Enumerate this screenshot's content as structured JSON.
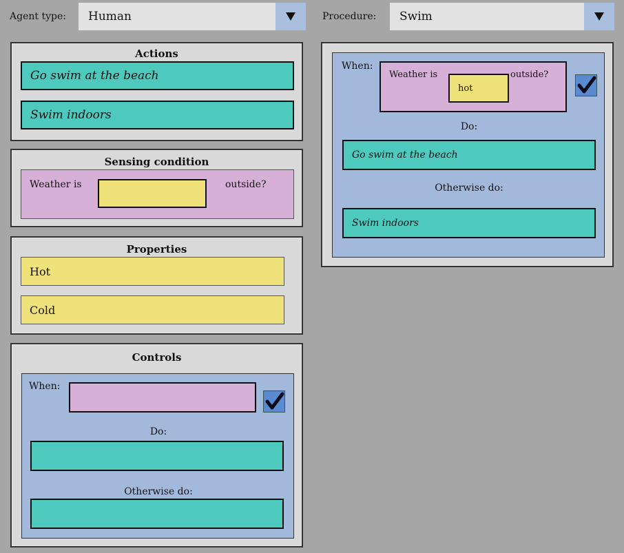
{
  "agent_type": {
    "label": "Agent type:",
    "value": "Human"
  },
  "procedure": {
    "label": "Procedure:",
    "value": "Swim"
  },
  "actions": {
    "title": "Actions",
    "items": [
      "Go swim at the beach",
      "Swim indoors"
    ]
  },
  "sensing": {
    "title": "Sensing condition",
    "prefix": "Weather is",
    "suffix": "outside?"
  },
  "properties": {
    "title": "Properties",
    "items": [
      "Hot",
      "Cold"
    ]
  },
  "controls": {
    "title": "Controls",
    "when": "When:",
    "do": "Do:",
    "otherwise": "Otherwise do:",
    "checked": true
  },
  "procedure_body": {
    "when": "When:",
    "cond_prefix": "Weather is",
    "cond_value": "hot",
    "cond_suffix": "outside?",
    "checked": true,
    "do": "Do:",
    "do_action": "Go swim at the beach",
    "otherwise": "Otherwise do:",
    "otherwise_action": "Swim indoors"
  },
  "icons": {
    "dropdown": "dropdown-triangle-icon",
    "check": "checkmark-icon"
  },
  "colors": {
    "action": "#4ec9bd",
    "property": "#f0e27a",
    "sensing": "#d6b0d6",
    "control_area": "#a3b9dc",
    "panel": "#d9d9d9",
    "background": "#a6a6a6"
  }
}
